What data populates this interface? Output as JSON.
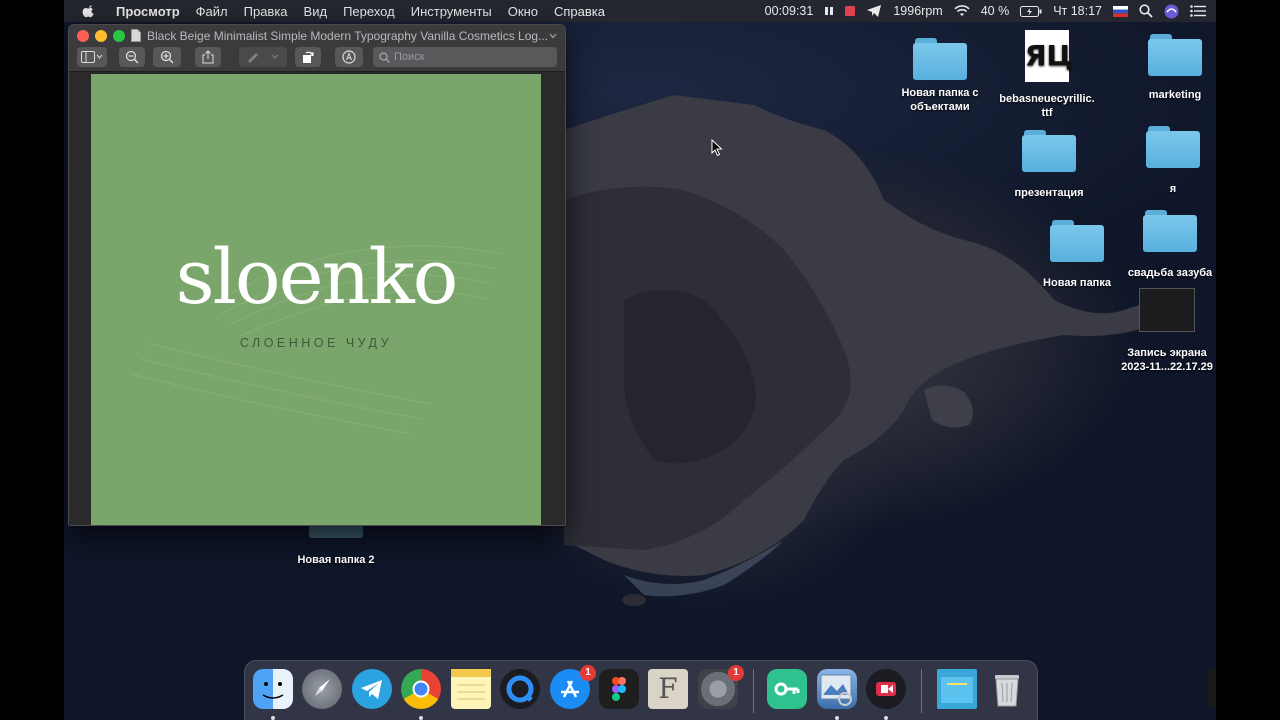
{
  "menubar": {
    "app_name": "Просмотр",
    "items": [
      "Файл",
      "Правка",
      "Вид",
      "Переход",
      "Инструменты",
      "Окно",
      "Справка"
    ],
    "timer": "00:09:31",
    "fan": "1996rpm",
    "battery": "40 %",
    "clock": "Чт 18:17"
  },
  "window": {
    "title": "Black Beige Minimalist Simple Modern Typography Vanilla Cosmetics Log...",
    "search_placeholder": "Поиск"
  },
  "document": {
    "logo_word": "sloenko",
    "logo_subtitle": "СЛОЕННОЕ ЧУДУ",
    "background_color": "#7ba66b"
  },
  "desktop": {
    "items": [
      {
        "label": "Новая папка с объектами",
        "icon": "folder-icon"
      },
      {
        "label": "bebasneuecyrillic. ttf",
        "icon": "font-file-icon",
        "file_glyph": "ЯЦ"
      },
      {
        "label": "marketing",
        "icon": "folder-icon"
      },
      {
        "label": "презентация",
        "icon": "folder-icon"
      },
      {
        "label": "я",
        "icon": "folder-icon"
      },
      {
        "label": "Новая папка",
        "icon": "folder-icon"
      },
      {
        "label": "свадьба зазуба",
        "icon": "folder-icon"
      },
      {
        "label": "Запись экрана 2023-11...22.17.29",
        "icon": "screen-recording-icon"
      },
      {
        "label": "Новая папка 2",
        "icon": "folder-icon"
      }
    ]
  },
  "dock": {
    "apps": [
      {
        "name": "finder-icon"
      },
      {
        "name": "launchpad-icon"
      },
      {
        "name": "telegram-icon"
      },
      {
        "name": "chrome-icon"
      },
      {
        "name": "notes-icon"
      },
      {
        "name": "quicktime-icon"
      },
      {
        "name": "app-store-icon",
        "badge": "1"
      },
      {
        "name": "figma-icon"
      },
      {
        "name": "fontbook-icon",
        "glyph": "F"
      },
      {
        "name": "system-preferences-icon",
        "badge": "1"
      },
      {
        "name": "vpn-key-icon"
      },
      {
        "name": "preview-icon"
      },
      {
        "name": "screen-recorder-icon"
      },
      {
        "name": "downloads-stack-icon"
      },
      {
        "name": "trash-icon"
      }
    ]
  }
}
